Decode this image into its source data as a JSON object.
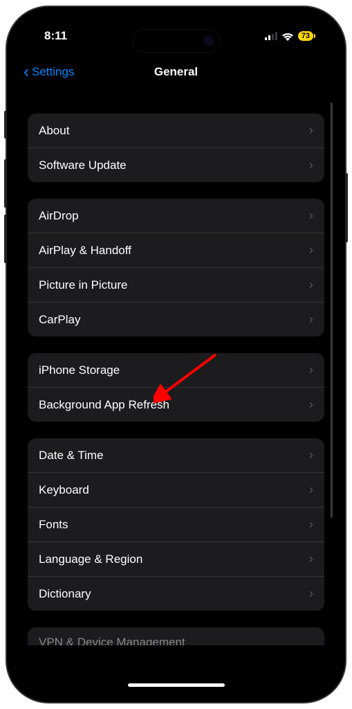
{
  "status": {
    "time": "8:11",
    "battery_level": "73"
  },
  "nav": {
    "back_label": "Settings",
    "title": "General"
  },
  "groups": [
    {
      "items": [
        {
          "label": "About",
          "name": "row-about"
        },
        {
          "label": "Software Update",
          "name": "row-software-update"
        }
      ]
    },
    {
      "items": [
        {
          "label": "AirDrop",
          "name": "row-airdrop"
        },
        {
          "label": "AirPlay & Handoff",
          "name": "row-airplay-handoff"
        },
        {
          "label": "Picture in Picture",
          "name": "row-picture-in-picture"
        },
        {
          "label": "CarPlay",
          "name": "row-carplay"
        }
      ]
    },
    {
      "items": [
        {
          "label": "iPhone Storage",
          "name": "row-iphone-storage"
        },
        {
          "label": "Background App Refresh",
          "name": "row-background-app-refresh"
        }
      ]
    },
    {
      "items": [
        {
          "label": "Date & Time",
          "name": "row-date-time"
        },
        {
          "label": "Keyboard",
          "name": "row-keyboard"
        },
        {
          "label": "Fonts",
          "name": "row-fonts"
        },
        {
          "label": "Language & Region",
          "name": "row-language-region"
        },
        {
          "label": "Dictionary",
          "name": "row-dictionary"
        }
      ]
    }
  ],
  "cutoff_row_label": "VPN & Device Management",
  "annotation": {
    "color": "#ff0000"
  }
}
